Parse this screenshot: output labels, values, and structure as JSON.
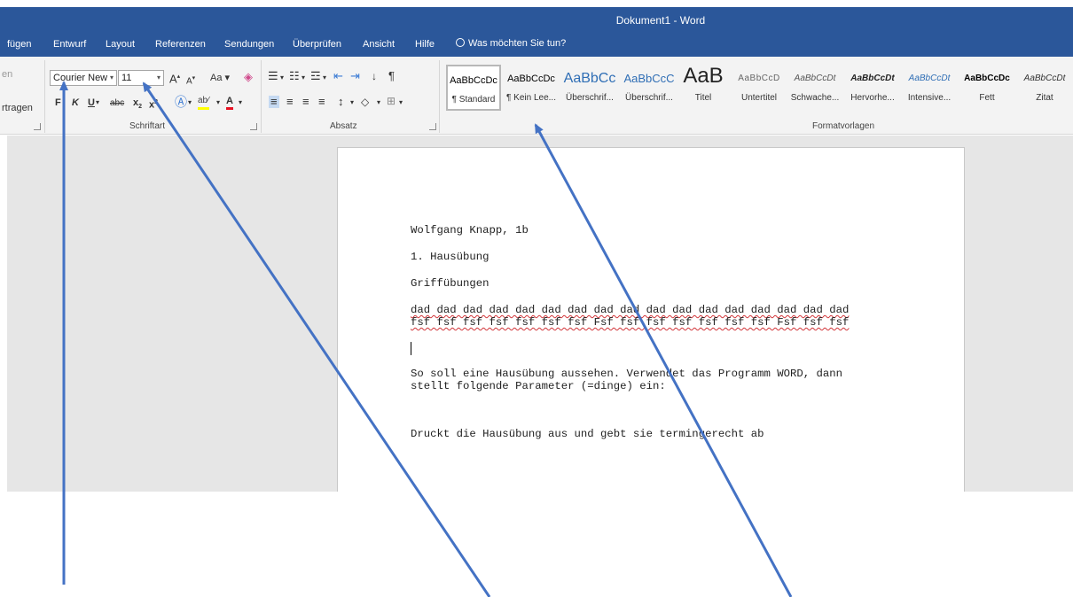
{
  "titlebar": {
    "title": "Dokument1 - Word"
  },
  "tabs": [
    "fügen",
    "Entwurf",
    "Layout",
    "Referenzen",
    "Sendungen",
    "Überprüfen",
    "Ansicht",
    "Hilfe"
  ],
  "tell_me": "Was möchten Sie tun?",
  "ribbon": {
    "left_top_cut": "en",
    "left_bottom_cut": "rtragen",
    "font_name": "Courier New",
    "font_size": "11",
    "case_label": "Aa",
    "bold": "F",
    "italic": "K",
    "underline": "U",
    "strike": "abc",
    "sub": "x",
    "sup": "x",
    "group_font": "Schriftart",
    "group_paragraph": "Absatz",
    "group_styles": "Formatvorlagen",
    "highlight_color": "#ffff00",
    "font_color": "#e81123",
    "styles": [
      {
        "sample": "AaBbCcDc",
        "name": "¶ Standard",
        "selected": true
      },
      {
        "sample": "AaBbCcDc",
        "name": "¶ Kein Lee..."
      },
      {
        "sample": "AaBbCc",
        "name": "Überschrif..."
      },
      {
        "sample": "AaBbCcC",
        "name": "Überschrif..."
      },
      {
        "sample": "AaB",
        "name": "Titel"
      },
      {
        "sample": "AaBbCcD",
        "name": "Untertitel"
      },
      {
        "sample": "AaBbCcDt",
        "name": "Schwache..."
      },
      {
        "sample": "AaBbCcDt",
        "name": "Hervorhe..."
      },
      {
        "sample": "AaBbCcDt",
        "name": "Intensive..."
      },
      {
        "sample": "AaBbCcDc",
        "name": "Fett"
      },
      {
        "sample": "AaBbCcDt",
        "name": "Zitat"
      }
    ]
  },
  "document": {
    "line1": "Wolfgang Knapp, 1b",
    "line2": "1. Hausübung",
    "line3": "Griffübungen",
    "dad_line": "dad dad dad dad dad dad dad dad dad dad dad dad dad dad dad dad dad",
    "fsf_line": "fsf fsf fsf fsf fsf fsf fsf Fsf fsf fsf fsf fsf fsf fsf Fsf fsf fsf",
    "para1": "So soll eine Hausübung aussehen. Verwendet das Programm WORD, dann",
    "para2": "stellt folgende Parameter (=dinge) ein:",
    "para3": "Druckt die Hausübung aus und gebt sie termingerecht ab"
  },
  "colors": {
    "accent": "#2b579a",
    "arrow": "#4472c4"
  }
}
